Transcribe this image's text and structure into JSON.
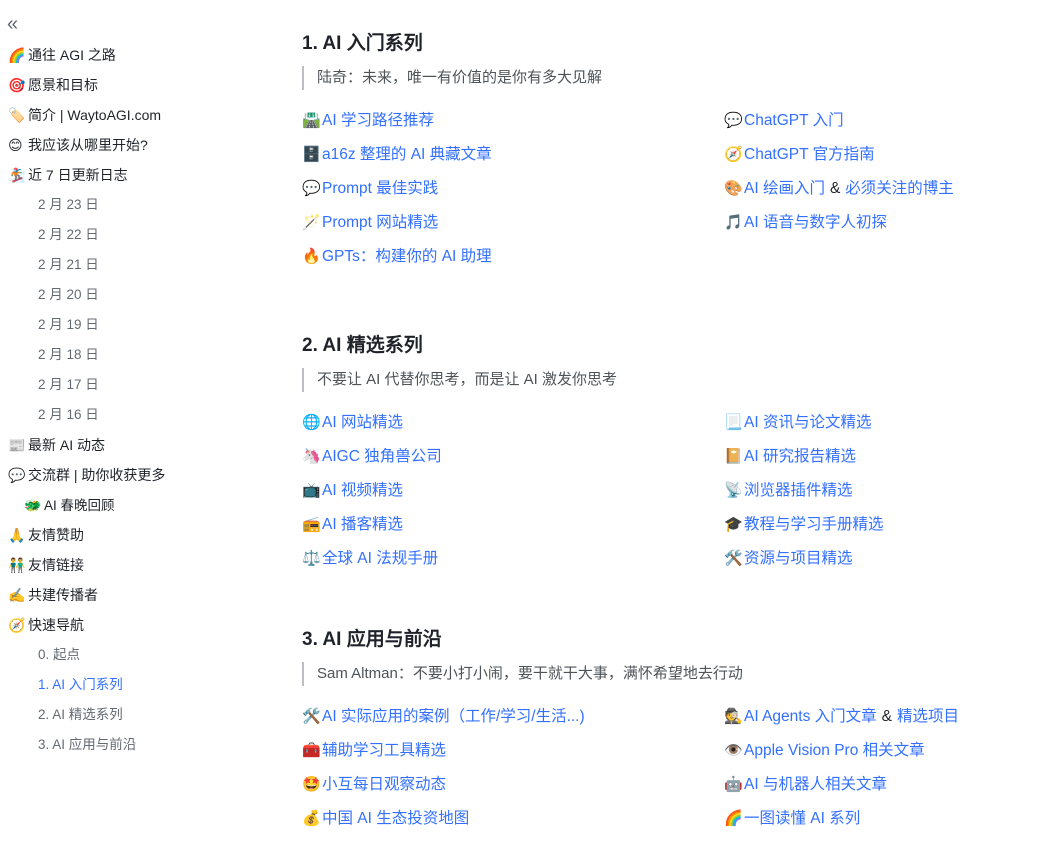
{
  "sidebar": {
    "collapse_icon": "«",
    "items": [
      {
        "emoji": "🌈",
        "label": "通往 AGI 之路",
        "level": 0
      },
      {
        "emoji": "🎯",
        "label": "愿景和目标",
        "level": 0
      },
      {
        "emoji": "🏷️",
        "label": "简介 | WaytoAGI.com",
        "level": 0
      },
      {
        "emoji": "😊",
        "label": "我应该从哪里开始?",
        "level": 0
      },
      {
        "emoji": "🏂",
        "label": "近 7 日更新日志",
        "level": 0
      },
      {
        "emoji": "",
        "label": "2 月 23 日",
        "level": 1
      },
      {
        "emoji": "",
        "label": "2 月 22 日",
        "level": 1
      },
      {
        "emoji": "",
        "label": "2 月 21 日",
        "level": 1
      },
      {
        "emoji": "",
        "label": "2 月 20 日",
        "level": 1
      },
      {
        "emoji": "",
        "label": "2 月 19 日",
        "level": 1
      },
      {
        "emoji": "",
        "label": "2 月 18 日",
        "level": 1
      },
      {
        "emoji": "",
        "label": "2 月 17 日",
        "level": 1
      },
      {
        "emoji": "",
        "label": "2 月 16 日",
        "level": 1
      },
      {
        "emoji": "📰",
        "label": "最新 AI 动态",
        "level": 0
      },
      {
        "emoji": "💬",
        "label": "交流群 | 助你收获更多",
        "level": 0
      },
      {
        "emoji": "🐲",
        "label": "AI 春晚回顾",
        "level": 2
      },
      {
        "emoji": "🙏",
        "label": "友情赞助",
        "level": 0
      },
      {
        "emoji": "👬",
        "label": "友情链接",
        "level": 0
      },
      {
        "emoji": "✍️",
        "label": "共建传播者",
        "level": 0
      },
      {
        "emoji": "🧭",
        "label": "快速导航",
        "level": 0
      },
      {
        "emoji": "",
        "label": "0. 起点",
        "level": 1
      },
      {
        "emoji": "",
        "label": "1. AI 入门系列",
        "level": 1,
        "active": true
      },
      {
        "emoji": "",
        "label": "2. AI 精选系列",
        "level": 1
      },
      {
        "emoji": "",
        "label": "3. AI 应用与前沿",
        "level": 1
      }
    ]
  },
  "sections": [
    {
      "title": "1. AI 入门系列",
      "quote": "陆奇：未来，唯一有价值的是你有多大见解",
      "rows": [
        {
          "left": {
            "emoji": "🛣️",
            "label": "AI 学习路径推荐"
          },
          "right": {
            "emoji": "💬",
            "label": "ChatGPT 入门"
          }
        },
        {
          "left": {
            "emoji": "🗄️",
            "label": "a16z 整理的 AI 典藏文章"
          },
          "right": {
            "emoji": "🧭",
            "label": "ChatGPT 官方指南"
          }
        },
        {
          "left": {
            "emoji": "💬",
            "label": "Prompt 最佳实践"
          },
          "right": {
            "emoji": "🎨",
            "label": "AI 绘画入门",
            "amp": "&",
            "label2": "必须关注的博主"
          }
        },
        {
          "left": {
            "emoji": "🪄",
            "label": "Prompt 网站精选"
          },
          "right": {
            "emoji": "🎵",
            "label": "AI 语音与数字人初探"
          }
        },
        {
          "left": {
            "emoji": "🔥",
            "label": "GPTs：构建你的 AI 助理"
          }
        }
      ]
    },
    {
      "title": "2. AI 精选系列",
      "quote": "不要让 AI 代替你思考，而是让 AI 激发你思考",
      "rows": [
        {
          "left": {
            "emoji": "🌐",
            "label": "AI 网站精选"
          },
          "right": {
            "emoji": "📃",
            "label": "AI 资讯与论文精选"
          }
        },
        {
          "left": {
            "emoji": "🦄",
            "label": "AIGC 独角兽公司"
          },
          "right": {
            "emoji": "📔",
            "label": "AI 研究报告精选"
          }
        },
        {
          "left": {
            "emoji": "📺",
            "label": "AI 视频精选"
          },
          "right": {
            "emoji": "📡",
            "label": "浏览器插件精选"
          }
        },
        {
          "left": {
            "emoji": "📻",
            "label": "AI 播客精选"
          },
          "right": {
            "emoji": "🎓",
            "label": "教程与学习手册精选"
          }
        },
        {
          "left": {
            "emoji": "⚖️",
            "label": "全球 AI 法规手册"
          },
          "right": {
            "emoji": "🛠️",
            "label": "资源与项目精选"
          }
        }
      ]
    },
    {
      "title": "3. AI 应用与前沿",
      "quote": "Sam Altman：不要小打小闹，要干就干大事，满怀希望地去行动",
      "rows": [
        {
          "left": {
            "emoji": "🛠️",
            "label": "AI 实际应用的案例（工作/学习/生活...)"
          },
          "right": {
            "emoji": "🕵️",
            "label": "AI Agents 入门文章",
            "amp": "&",
            "label2": "精选项目"
          }
        },
        {
          "left": {
            "emoji": "🧰",
            "label": "辅助学习工具精选"
          },
          "right": {
            "emoji": "👁️",
            "label": "Apple Vision Pro 相关文章"
          }
        },
        {
          "left": {
            "emoji": "🤩",
            "label": "小互每日观察动态"
          },
          "right": {
            "emoji": "🤖",
            "label": "AI 与机器人相关文章"
          }
        },
        {
          "left": {
            "emoji": "💰",
            "label": "中国 AI 生态投资地图"
          },
          "right": {
            "emoji": "🌈",
            "label": "一图读懂 AI 系列"
          }
        }
      ]
    }
  ],
  "colors": {
    "link": "#3370ff",
    "text": "#1f2329",
    "muted": "#646a73"
  }
}
